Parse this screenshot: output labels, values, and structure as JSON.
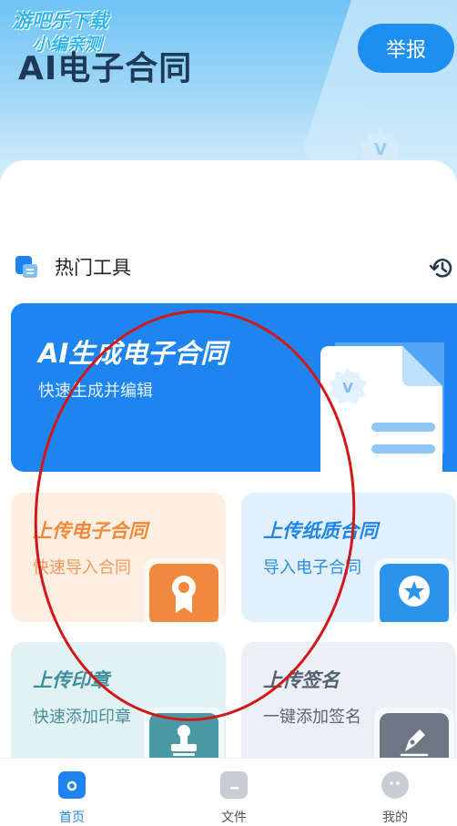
{
  "watermark": {
    "line1": "游吧乐下载",
    "line2": "小编亲测"
  },
  "header": {
    "title": "AI电子合同",
    "report_label": "举报"
  },
  "section": {
    "title": "热门工具"
  },
  "hero": {
    "title": "AI生成电子合同",
    "subtitle": "快速生成并编辑"
  },
  "cards": [
    {
      "title": "上传电子合同",
      "subtitle": "快速导入合同",
      "icon": "award-icon"
    },
    {
      "title": "上传纸质合同",
      "subtitle": "导入电子合同",
      "icon": "star-badge-icon"
    },
    {
      "title": "上传印章",
      "subtitle": "快速添加印章",
      "icon": "stamp-icon"
    },
    {
      "title": "上传签名",
      "subtitle": "一键添加签名",
      "icon": "pen-icon"
    }
  ],
  "tabbar": {
    "items": [
      {
        "label": "首页",
        "active": true
      },
      {
        "label": "文件",
        "active": false
      },
      {
        "label": "我的",
        "active": false
      }
    ]
  },
  "colors": {
    "primary": "#1d84f0",
    "annotation": "#d01818"
  }
}
